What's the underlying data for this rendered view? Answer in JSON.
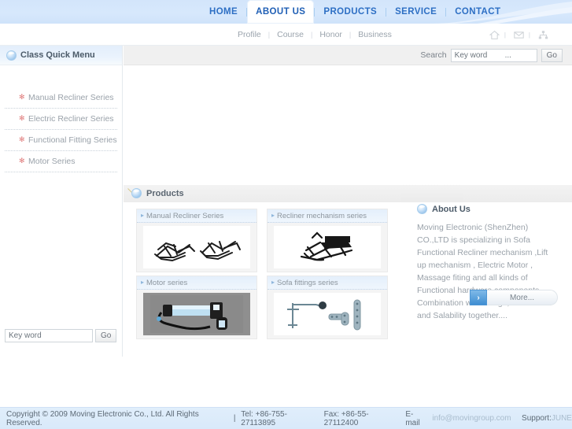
{
  "topnav": {
    "items": [
      {
        "label": "HOME",
        "active": false
      },
      {
        "label": "ABOUT US",
        "active": true
      },
      {
        "label": "PRODUCTS",
        "active": false
      },
      {
        "label": "SERVICE",
        "active": false
      },
      {
        "label": "CONTACT",
        "active": false
      }
    ]
  },
  "subnav": {
    "items": [
      {
        "label": "Profile"
      },
      {
        "label": "Course"
      },
      {
        "label": "Honor"
      },
      {
        "label": "Business"
      }
    ],
    "icons": [
      {
        "name": "home-icon"
      },
      {
        "name": "mail-icon"
      },
      {
        "name": "sitemap-icon"
      }
    ]
  },
  "sidebar": {
    "header": {
      "title": "Class Quick Menu",
      "icon": "orb-icon"
    },
    "items": [
      {
        "label": "Manual Recliner Series"
      },
      {
        "label": "Electric Recliner Series"
      },
      {
        "label": "Functional Fitting Series"
      },
      {
        "label": "Motor Series"
      }
    ],
    "search": {
      "value": "Key word",
      "placeholder": "Key word",
      "go_label": "Go"
    }
  },
  "search": {
    "label": "Search",
    "value": "Key word        ...",
    "placeholder": "Key word",
    "go_label": "Go"
  },
  "products": {
    "title": "Products",
    "cards": [
      {
        "label": "Manual Recliner Series",
        "image": "recliner-frames-photo"
      },
      {
        "label": "Recliner mechanism series",
        "image": "recliner-mechanism-photo"
      },
      {
        "label": "Motor series",
        "image": "linear-motor-photo"
      },
      {
        "label": "Sofa fittings series",
        "image": "sofa-fittings-photo"
      }
    ]
  },
  "about": {
    "title": "About Us",
    "body": "Moving Electronic (ShenZhen) CO.,LTD is specializing in Sofa Functional Recliner mechanism ,Lift up mechanism , Electric Motor , Massage fiting and all kinds of Functional hardware components , Combination with design, Production and Salability together....",
    "more_label": "More...",
    "more_arrow": "›"
  },
  "footer": {
    "copyright": "Copyright © 2009 Moving Electronic Co., Ltd. All Rights Reserved.",
    "divider": "|",
    "tel": "Tel: +86-755-27113895",
    "fax": "Fax: +86-55-27112400",
    "email_label": "E-mail",
    "email": "info@movingroup.com",
    "support_label": "Support:",
    "support_value": "JUNE"
  },
  "colors": {
    "nav_blue": "#d6e7fa",
    "nav_text": "#2d6fc4",
    "accent": "#3f8ed2",
    "muted_text": "#9aa2aa",
    "footer_bg": "#dceafb"
  }
}
